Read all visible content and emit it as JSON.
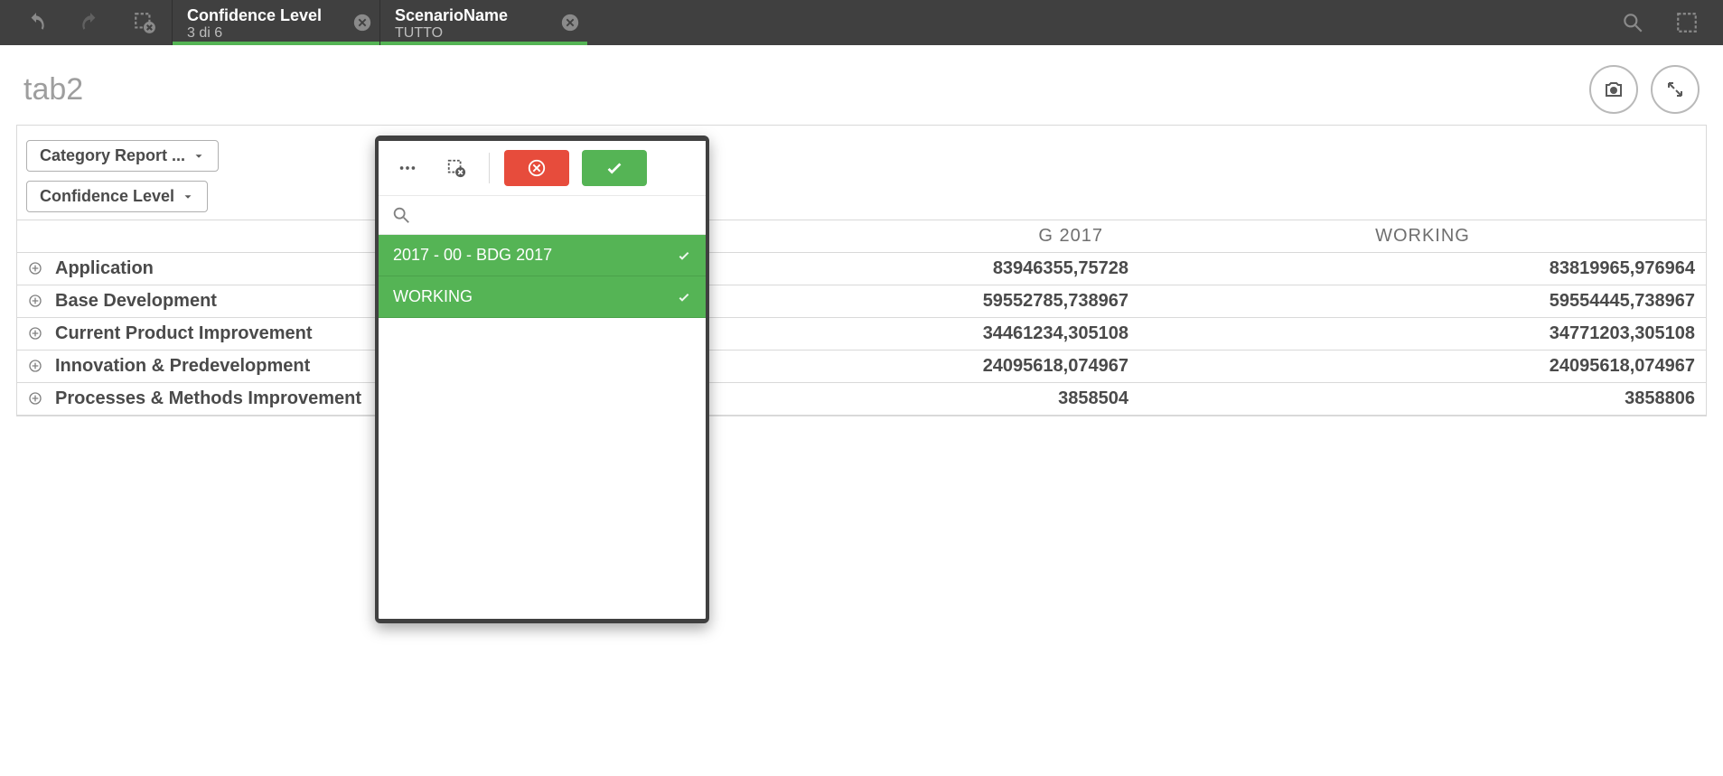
{
  "toolbar": {
    "selections": [
      {
        "title": "Confidence Level",
        "value": "3 di 6"
      },
      {
        "title": "ScenarioName",
        "value": "TUTTO"
      }
    ]
  },
  "sheet": {
    "title": "tab2"
  },
  "table": {
    "dim_buttons": [
      {
        "label": "Category Report ..."
      },
      {
        "label": "Confidence Level"
      }
    ],
    "columns": [
      {
        "label": ""
      },
      {
        "label": "G 2017"
      },
      {
        "label": "WORKING"
      }
    ],
    "rows": [
      {
        "label": "Application",
        "values": [
          "83946355,75728",
          "83819965,976964"
        ]
      },
      {
        "label": "Base Development",
        "values": [
          "59552785,738967",
          "59554445,738967"
        ]
      },
      {
        "label": "Current Product Improvement",
        "values": [
          "34461234,305108",
          "34771203,305108"
        ]
      },
      {
        "label": "Innovation & Predevelopment",
        "values": [
          "24095618,074967",
          "24095618,074967"
        ]
      },
      {
        "label": "Processes & Methods Improvement",
        "values": [
          "3858504",
          "3858806"
        ]
      }
    ]
  },
  "popup": {
    "search_placeholder": "",
    "items": [
      {
        "label": "2017 - 00 - BDG 2017",
        "selected": true
      },
      {
        "label": "WORKING",
        "selected": true
      }
    ]
  }
}
